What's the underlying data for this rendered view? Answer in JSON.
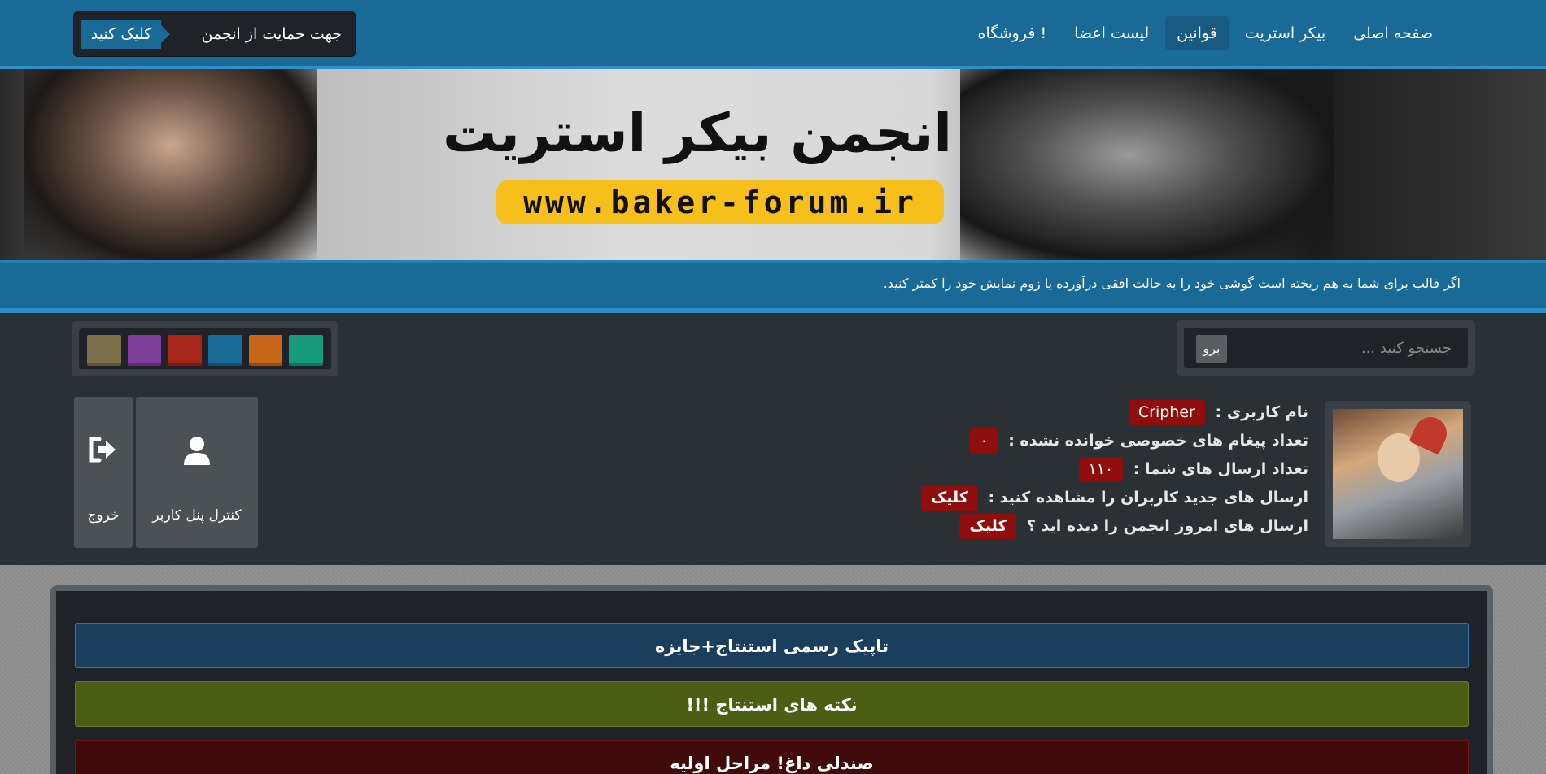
{
  "nav": {
    "items": [
      {
        "label": "صفحه اصلی",
        "active": false
      },
      {
        "label": "بیکر استریت",
        "active": false
      },
      {
        "label": "قوانین",
        "active": true
      },
      {
        "label": "لیست اعضا",
        "active": false
      },
      {
        "label": "فروشگاه !",
        "active": false
      }
    ]
  },
  "support": {
    "text": "جهت حمایت از انجمن",
    "button": "کلیک کنید"
  },
  "banner": {
    "title": "انجمن بیکر استریت",
    "url": "www.baker-forum.ir"
  },
  "notice": {
    "text": "اگر قالب برای شما به هم ریخته است گوشی خود را به حالت افقی درآورده یا زوم نمایش خود را کمتر کنید."
  },
  "search": {
    "placeholder": "جستجو کنید ...",
    "button": "برو"
  },
  "swatches": [
    "#7b7049",
    "#7d3e9a",
    "#a8251a",
    "#1a6a97",
    "#c8661a",
    "#169a7a"
  ],
  "user": {
    "username_label": "نام کاربری :",
    "username": "Cripher",
    "unread_label": "تعداد پیغام های خصوصی خوانده نشده :",
    "unread_count": "۰",
    "posts_label": "تعداد ارسال های شما :",
    "posts_count": "۱۱۰",
    "new_posts_label": "ارسال های جدید کاربران را مشاهده کنید :",
    "new_posts_button": "کلیک",
    "today_posts_label": "ارسال های امروز انجمن را دیده اید ؟",
    "today_posts_button": "کلیک"
  },
  "panel": {
    "ucp_label": "کنترل پنل کاربر",
    "logout_label": "خروج"
  },
  "topics": [
    {
      "label": "تاپیک رسمی استنتاج+جایزه"
    },
    {
      "label": "نکته های استنتاج !!!"
    },
    {
      "label": "صندلی داغ! مراحل اولیه"
    }
  ]
}
